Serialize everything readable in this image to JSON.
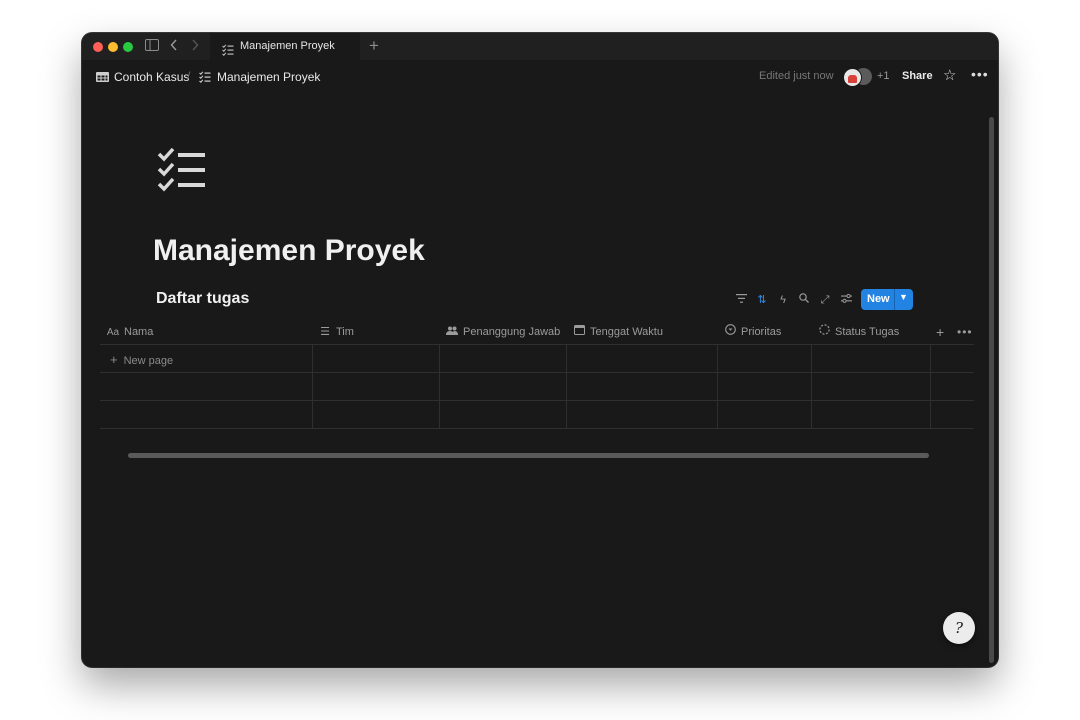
{
  "tab": {
    "title": "Manajemen Proyek"
  },
  "breadcrumb": [
    {
      "label": "Contoh Kasus",
      "icon": "table-icon"
    },
    {
      "label": "Manajemen Proyek",
      "icon": "checklist-icon"
    }
  ],
  "breadcrumb_separator": "/",
  "topbar": {
    "edited": "Edited just now",
    "collaborators_extra": "+1",
    "share_label": "Share"
  },
  "page": {
    "icon": "checklist-icon",
    "title": "Manajemen Proyek"
  },
  "database": {
    "title": "Daftar tugas",
    "new_label": "New",
    "toolbar_icons": [
      "filter-icon",
      "sort-icon",
      "automation-icon",
      "search-icon",
      "expand-icon",
      "settings-icon"
    ],
    "columns": [
      {
        "label": "Nama",
        "icon": "text-icon"
      },
      {
        "label": "Tim",
        "icon": "list-icon"
      },
      {
        "label": "Penanggung Jawab",
        "icon": "people-icon"
      },
      {
        "label": "Tenggat Waktu",
        "icon": "calendar-icon"
      },
      {
        "label": "Prioritas",
        "icon": "select-icon"
      },
      {
        "label": "Status Tugas",
        "icon": "status-icon"
      }
    ],
    "new_page_label": "New page"
  },
  "colors": {
    "background": "#191919",
    "accent": "#2383e2",
    "text": "#f0f0f0",
    "muted": "#9b9b9b"
  }
}
